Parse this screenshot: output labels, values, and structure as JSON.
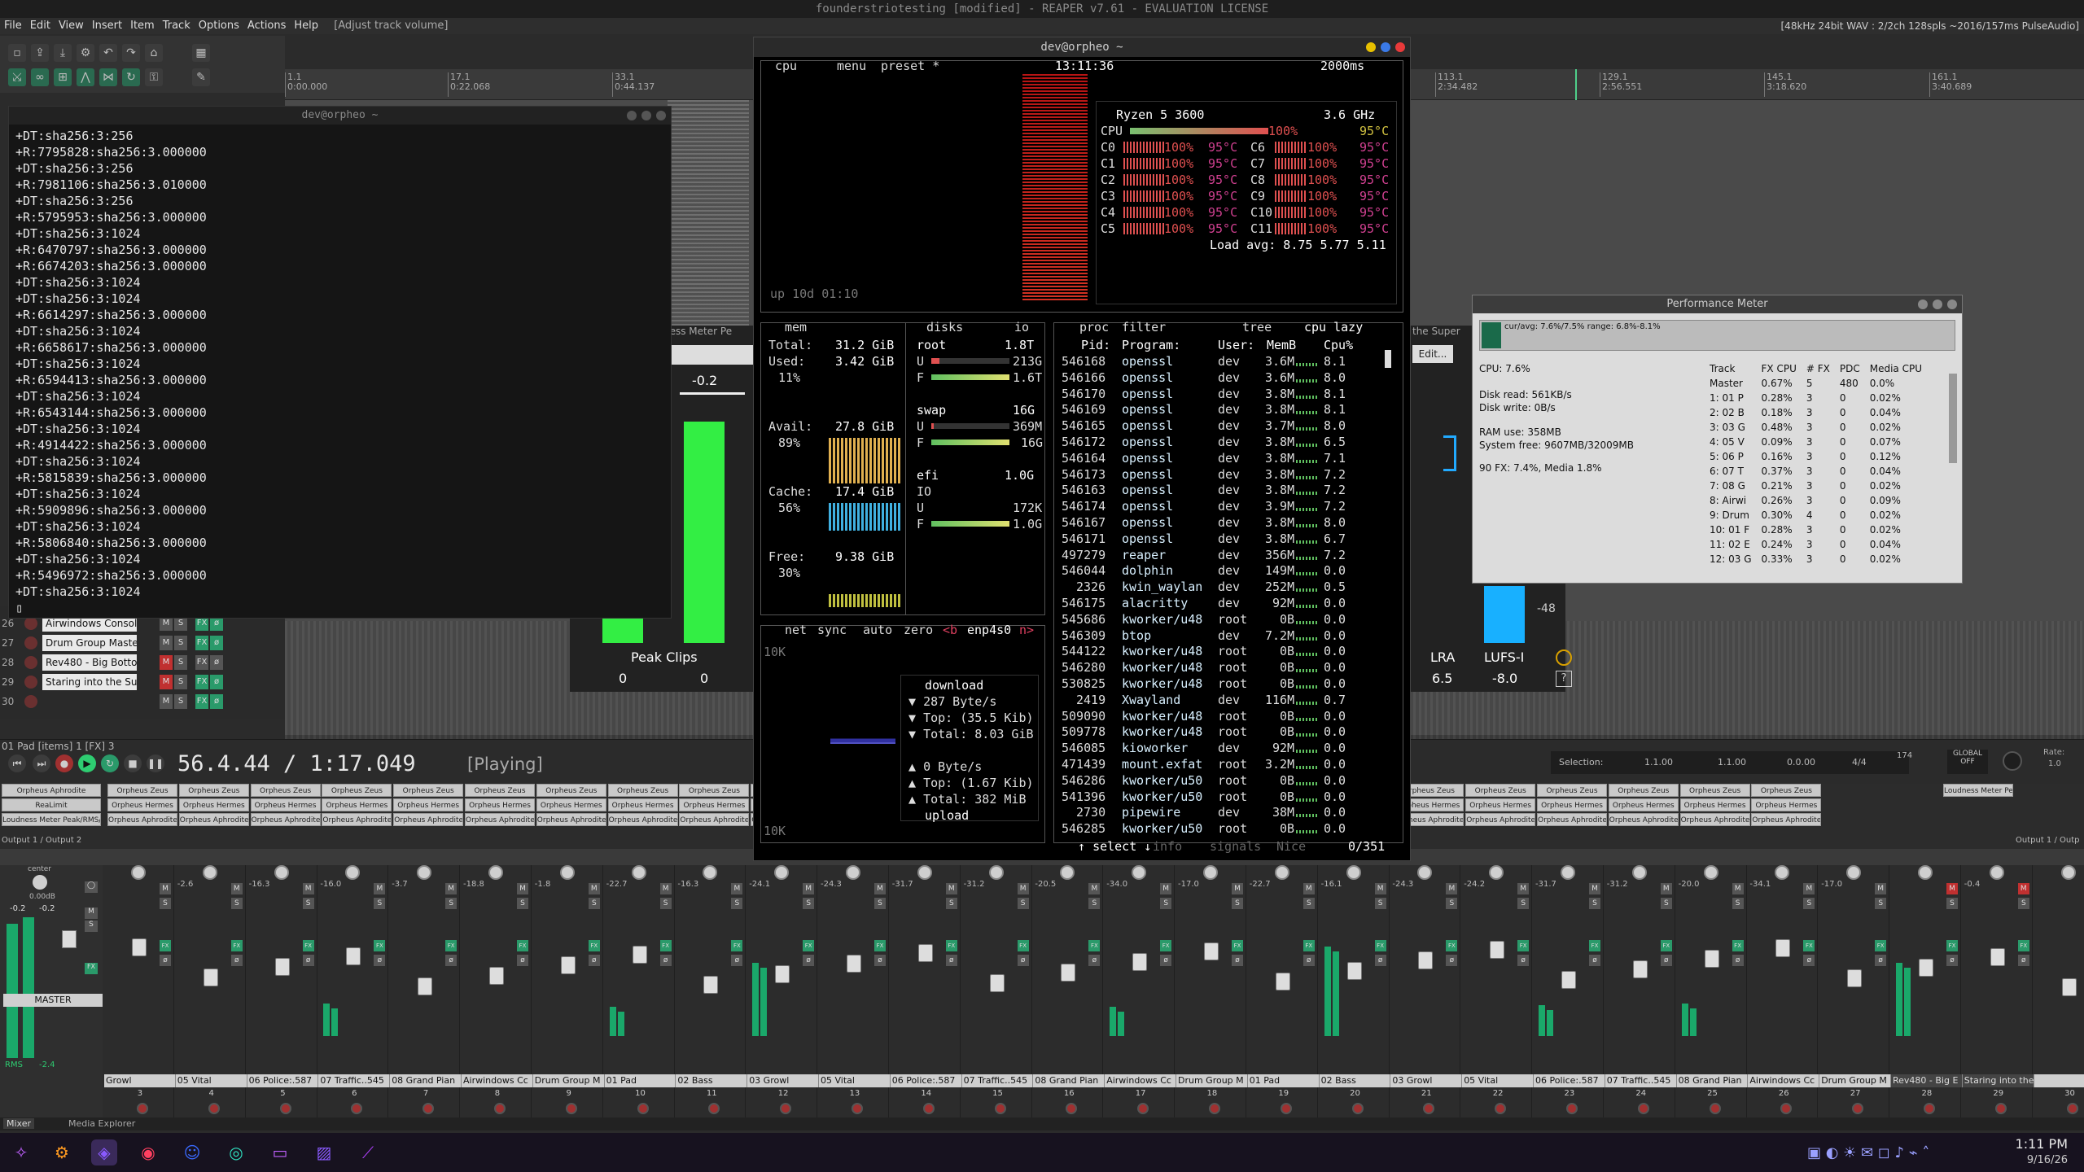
{
  "window": {
    "title": "founderstriotesting [modified] - REAPER v7.61 - EVALUATION LICENSE"
  },
  "menu": {
    "items": [
      "File",
      "Edit",
      "View",
      "Insert",
      "Item",
      "Track",
      "Options",
      "Actions",
      "Help"
    ],
    "hint": "[Adjust track volume]",
    "status": "[48kHz 24bit WAV : 2/2ch 128spls ~2016/157ms PulseAudio]"
  },
  "ruler": {
    "marks": [
      {
        "bar": "1.1",
        "time": "0:00.000"
      },
      {
        "bar": "17.1",
        "time": "0:22.068"
      },
      {
        "bar": "33.1",
        "time": "0:44.137"
      },
      {
        "bar": "113.1",
        "time": "2:34.482"
      },
      {
        "bar": "129.1",
        "time": "2:56.551"
      },
      {
        "bar": "145.1",
        "time": "3:18.620"
      },
      {
        "bar": "161.1",
        "time": "3:40.689"
      }
    ]
  },
  "terminal1": {
    "title": "dev@orpheo ~",
    "lines": [
      "+DT:sha256:3:256",
      "+R:7795828:sha256:3.000000",
      "+DT:sha256:3:256",
      "+R:7981106:sha256:3.010000",
      "+DT:sha256:3:256",
      "+R:5795953:sha256:3.000000",
      "+DT:sha256:3:1024",
      "+R:6470797:sha256:3.000000",
      "+R:6674203:sha256:3.000000",
      "+DT:sha256:3:1024",
      "+DT:sha256:3:1024",
      "+R:6614297:sha256:3.000000",
      "+DT:sha256:3:1024",
      "+R:6658617:sha256:3.000000",
      "+DT:sha256:3:1024",
      "+R:6594413:sha256:3.000000",
      "+DT:sha256:3:1024",
      "+R:6543144:sha256:3.000000",
      "+DT:sha256:3:1024",
      "+R:4914422:sha256:3.000000",
      "+DT:sha256:3:1024",
      "+R:5815839:sha256:3.000000",
      "+DT:sha256:3:1024",
      "+R:5909896:sha256:3.000000",
      "+DT:sha256:3:1024",
      "+R:5806840:sha256:3.000000",
      "+DT:sha256:3:1024",
      "+R:5496972:sha256:3.000000",
      "+DT:sha256:3:1024"
    ]
  },
  "tracks": [
    {
      "num": "26",
      "name": "Airwindows Consol"
    },
    {
      "num": "27",
      "name": "Drum Group Maste"
    },
    {
      "num": "28",
      "name": "Rev480 - Big Botto"
    },
    {
      "num": "29",
      "name": "Staring into the Su"
    },
    {
      "num": "30",
      "name": ""
    }
  ],
  "btop": {
    "title": "dev@orpheo ~",
    "cpu_tab": "cpu",
    "menu_tab": "menu",
    "preset_tab": "preset *",
    "clock": "13:11:36",
    "interval": "2000ms",
    "cpu_model": "Ryzen 5 3600",
    "cpu_freq": "3.6 GHz",
    "uptime": "up 10d 01:10",
    "cpu_total": {
      "label": "CPU",
      "pct": "100%",
      "temp": "95°C"
    },
    "cores": [
      {
        "l": "C0",
        "p": "100%",
        "t": "95°C",
        "r": "C6",
        "rp": "100%",
        "rt": "95°C"
      },
      {
        "l": "C1",
        "p": "100%",
        "t": "95°C",
        "r": "C7",
        "rp": "100%",
        "rt": "95°C"
      },
      {
        "l": "C2",
        "p": "100%",
        "t": "95°C",
        "r": "C8",
        "rp": "100%",
        "rt": "95°C"
      },
      {
        "l": "C3",
        "p": "100%",
        "t": "95°C",
        "r": "C9",
        "rp": "100%",
        "rt": "95°C"
      },
      {
        "l": "C4",
        "p": "100%",
        "t": "95°C",
        "r": "C10",
        "rp": "100%",
        "rt": "95°C"
      },
      {
        "l": "C5",
        "p": "100%",
        "t": "95°C",
        "r": "C11",
        "rp": "100%",
        "rt": "95°C"
      }
    ],
    "load_avg": "Load avg: 8.75 5.77 5.11",
    "mem": {
      "title": "mem",
      "total_l": "Total:",
      "total": "31.2 GiB",
      "used_l": "Used:",
      "used": "3.42 GiB",
      "used_p": "11%",
      "avail_l": "Avail:",
      "avail": "27.8 GiB",
      "avail_p": "89%",
      "cache_l": "Cache:",
      "cache": "17.4 GiB",
      "cache_p": "56%",
      "free_l": "Free:",
      "free": "9.38 GiB",
      "free_p": "30%"
    },
    "disks": {
      "title": "disks",
      "io": "io",
      "root": "root",
      "root_size": "1.8T",
      "root_u": "213G",
      "root_f": "1.6T",
      "swap": "swap",
      "swap_size": "16G",
      "swap_u": "369M",
      "swap_f": "16G",
      "efi": "efi",
      "efi_size": "1.0G",
      "efi_io": "IO",
      "efi_u": "172K",
      "efi_f": "1.0G"
    },
    "net": {
      "title": "net",
      "sync": "sync",
      "auto": "auto",
      "zero": "zero",
      "b": "<b",
      "iface": "enp4s0",
      "n": "n>",
      "scale_top": "10K",
      "scale_bot": "10K",
      "download": "download",
      "dl_rate": "287 Byte/s",
      "dl_top": "Top: (35.5 Kib)",
      "dl_total": "Total: 8.03 GiB",
      "ul_rate": "0 Byte/s",
      "ul_top": "Top: (1.67 Kib)",
      "ul_total": "Total: 382 MiB",
      "upload": "upload"
    },
    "proc": {
      "title": "proc",
      "filter": "filter",
      "tree": "tree",
      "sort": "cpu lazy",
      "headers": [
        "Pid:",
        "Program:",
        "User:",
        "MemB",
        "Cpu%"
      ],
      "footer_select": "select",
      "footer_info": "info",
      "footer_signals": "signals",
      "footer_nice": "Nice",
      "count": "0/351",
      "rows": [
        [
          "546168",
          "openssl",
          "dev",
          "3.6M",
          "8.1"
        ],
        [
          "546166",
          "openssl",
          "dev",
          "3.6M",
          "8.0"
        ],
        [
          "546170",
          "openssl",
          "dev",
          "3.8M",
          "8.1"
        ],
        [
          "546169",
          "openssl",
          "dev",
          "3.8M",
          "8.1"
        ],
        [
          "546165",
          "openssl",
          "dev",
          "3.7M",
          "8.0"
        ],
        [
          "546172",
          "openssl",
          "dev",
          "3.8M",
          "6.5"
        ],
        [
          "546164",
          "openssl",
          "dev",
          "3.8M",
          "7.1"
        ],
        [
          "546173",
          "openssl",
          "dev",
          "3.8M",
          "7.2"
        ],
        [
          "546163",
          "openssl",
          "dev",
          "3.8M",
          "7.2"
        ],
        [
          "546174",
          "openssl",
          "dev",
          "3.9M",
          "7.2"
        ],
        [
          "546167",
          "openssl",
          "dev",
          "3.8M",
          "8.0"
        ],
        [
          "546171",
          "openssl",
          "dev",
          "3.8M",
          "6.7"
        ],
        [
          "497279",
          "reaper",
          "dev",
          "356M",
          "7.2"
        ],
        [
          "546044",
          "dolphin",
          "dev",
          "149M",
          "0.0"
        ],
        [
          "2326",
          "kwin_waylan",
          "dev",
          "252M",
          "0.5"
        ],
        [
          "546175",
          "alacritty",
          "dev",
          "92M",
          "0.0"
        ],
        [
          "545686",
          "kworker/u48",
          "root",
          "0B",
          "0.0"
        ],
        [
          "546309",
          "btop",
          "dev",
          "7.2M",
          "0.0"
        ],
        [
          "544122",
          "kworker/u48",
          "root",
          "0B",
          "0.0"
        ],
        [
          "546280",
          "kworker/u48",
          "root",
          "0B",
          "0.0"
        ],
        [
          "530825",
          "kworker/u48",
          "root",
          "0B",
          "0.0"
        ],
        [
          "2419",
          "Xwayland",
          "dev",
          "116M",
          "0.7"
        ],
        [
          "509090",
          "kworker/u48",
          "root",
          "0B",
          "0.0"
        ],
        [
          "509778",
          "kworker/u48",
          "root",
          "0B",
          "0.0"
        ],
        [
          "546085",
          "kioworker",
          "dev",
          "92M",
          "0.0"
        ],
        [
          "471439",
          "mount.exfat",
          "root",
          "3.2M",
          "0.0"
        ],
        [
          "546286",
          "kworker/u50",
          "root",
          "0B",
          "0.0"
        ],
        [
          "541396",
          "kworker/u50",
          "root",
          "0B",
          "0.0"
        ],
        [
          "2730",
          "pipewire",
          "dev",
          "38M",
          "0.0"
        ],
        [
          "546285",
          "kworker/u50",
          "root",
          "0B",
          "0.0"
        ]
      ]
    }
  },
  "perf": {
    "title": "Performance Meter",
    "graph_label": "cur/avg: 7.6%/7.5%  range: 6.8%-8.1%",
    "cpu": "CPU: 7.6%",
    "disk_read": "Disk read: 561KB/s",
    "disk_write": "Disk write: 0B/s",
    "ram": "RAM use: 358MB",
    "sysfree": "System free: 9607MB/32009MB",
    "fx": "90 FX: 7.4%, Media 1.8%",
    "headers": [
      "Track",
      "FX CPU",
      "# FX",
      "PDC",
      "Media CPU"
    ],
    "rows": [
      [
        "Master",
        "0.67%",
        "5",
        "480",
        "0.0%"
      ],
      [
        "1: 01 P",
        "0.28%",
        "3",
        "0",
        "0.02%"
      ],
      [
        "2: 02 B",
        "0.18%",
        "3",
        "0",
        "0.04%"
      ],
      [
        "3: 03 G",
        "0.48%",
        "3",
        "0",
        "0.02%"
      ],
      [
        "4: 05 V",
        "0.09%",
        "3",
        "0",
        "0.07%"
      ],
      [
        "5: 06 P",
        "0.16%",
        "3",
        "0",
        "0.12%"
      ],
      [
        "6: 07 T",
        "0.37%",
        "3",
        "0",
        "0.04%"
      ],
      [
        "7: 08 G",
        "0.21%",
        "3",
        "0",
        "0.02%"
      ],
      [
        "8: Airwi",
        "0.26%",
        "3",
        "0",
        "0.09%"
      ],
      [
        "9: Drum",
        "0.30%",
        "4",
        "0",
        "0.02%"
      ],
      [
        "10: 01 F",
        "0.28%",
        "3",
        "0",
        "0.02%"
      ],
      [
        "11: 02 E",
        "0.24%",
        "3",
        "0",
        "0.04%"
      ],
      [
        "12: 03 G",
        "0.33%",
        "3",
        "0",
        "0.02%"
      ]
    ]
  },
  "loudness": {
    "left_label": "ness Meter Pe",
    "value": "-0.2",
    "peak_clips": "Peak Clips",
    "pc_a": "0",
    "pc_b": "0",
    "lra": "LRA",
    "lra_val": "6.5",
    "lufs": "LUFS-I",
    "lufs_val": "-8.0",
    "right_label": "the Super",
    "edit": "Edit...",
    "scale": "-48",
    "q": "?"
  },
  "transport": {
    "items_info": "01 Pad [items] 1 [FX] 3",
    "time": "56.4.44 / 1:17.049",
    "state": "[Playing]",
    "selection_label": "Selection:",
    "sel_start": "1.1.00",
    "sel_end": "1.1.00",
    "sel_len": "0.0.00",
    "timesig": "4/4",
    "bpm": "174",
    "global": "GLOBAL",
    "off": "OFF",
    "rate_label": "Rate:",
    "rate": "1.0"
  },
  "mixer": {
    "master_fx": [
      "Orpheus Aphrodite",
      "ReaLimit",
      "Loudness Meter Peak/RMS/"
    ],
    "fx_col": [
      "Orpheus Zeus",
      "Orpheus Hermes",
      "Orpheus Aphrodite"
    ],
    "right_fx": "Loudness Meter Pe",
    "output_left": "Output 1 / Output 2",
    "output_right": "Output 1 / Outp",
    "master_label": "MASTER",
    "master_vol": "0.00dB",
    "master_l": "-0.2",
    "master_r": "-0.2",
    "center": "center",
    "rms": "RMS",
    "rms_val": "-2.4",
    "mixer_tab": "Mixer",
    "media_tab": "Media Explorer",
    "channels": [
      {
        "name": "Growl",
        "num": "3",
        "vol": ""
      },
      {
        "name": "05 Vital",
        "num": "4",
        "vol": "-2.6"
      },
      {
        "name": "06 Police:.587",
        "num": "5",
        "vol": "-16.3"
      },
      {
        "name": "07 Traffic..545",
        "num": "6",
        "vol": "-16.0"
      },
      {
        "name": "08 Grand Pian",
        "num": "7",
        "vol": "-3.7"
      },
      {
        "name": "Airwindows Cc",
        "num": "8",
        "vol": "-18.8"
      },
      {
        "name": "Drum Group M",
        "num": "9",
        "vol": "-1.8"
      },
      {
        "name": "01 Pad",
        "num": "10",
        "vol": "-22.7"
      },
      {
        "name": "02 Bass",
        "num": "11",
        "vol": "-16.3"
      },
      {
        "name": "03 Growl",
        "num": "12",
        "vol": "-24.1"
      },
      {
        "name": "05 Vital",
        "num": "13",
        "vol": "-24.3"
      },
      {
        "name": "06 Police:.587",
        "num": "14",
        "vol": "-31.7"
      },
      {
        "name": "07 Traffic..545",
        "num": "15",
        "vol": "-31.2"
      },
      {
        "name": "08 Grand Pian",
        "num": "16",
        "vol": "-20.5"
      },
      {
        "name": "Airwindows Cc",
        "num": "17",
        "vol": "-34.0"
      },
      {
        "name": "Drum Group M",
        "num": "18",
        "vol": "-17.0"
      },
      {
        "name": "01 Pad",
        "num": "19",
        "vol": "-22.7"
      },
      {
        "name": "02 Bass",
        "num": "20",
        "vol": "-16.1"
      },
      {
        "name": "03 Growl",
        "num": "21",
        "vol": "-24.3"
      },
      {
        "name": "05 Vital",
        "num": "22",
        "vol": "-24.2"
      },
      {
        "name": "06 Police:.587",
        "num": "23",
        "vol": "-31.7"
      },
      {
        "name": "07 Traffic..545",
        "num": "24",
        "vol": "-31.2"
      },
      {
        "name": "08 Grand Pian",
        "num": "25",
        "vol": "-20.0"
      },
      {
        "name": "Airwindows Cc",
        "num": "26",
        "vol": "-34.1"
      },
      {
        "name": "Drum Group M",
        "num": "27",
        "vol": "-17.0"
      },
      {
        "name": "Rev480 - Big E",
        "num": "28",
        "vol": ""
      },
      {
        "name": "Staring into the",
        "num": "29",
        "vol": "-0.4"
      },
      {
        "name": "",
        "num": "30",
        "vol": ""
      }
    ]
  },
  "taskbar": {
    "time": "1:11 PM",
    "date": "9/16/26"
  },
  "colors": {
    "meter": "#1aa86a",
    "accent": "#2ecc71",
    "btop_red": "#e0504a",
    "btop_pink": "#d04090"
  }
}
